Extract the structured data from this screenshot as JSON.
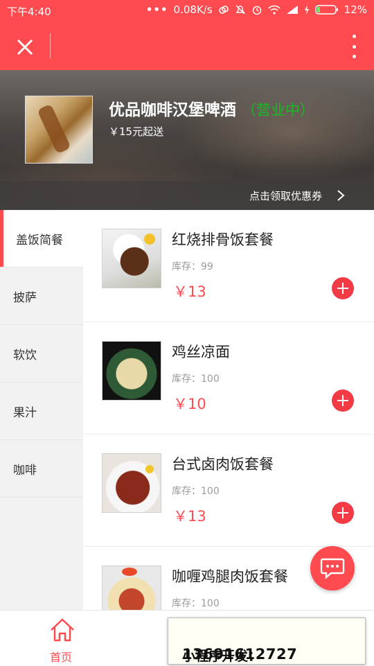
{
  "status": {
    "time": "下午4:40",
    "dots": "•••",
    "speed": "0.08K/s",
    "battery": "12%"
  },
  "shop": {
    "name": "优品咖啡汉堡啤酒",
    "status": "（营业中）",
    "min_order": "￥15元起送",
    "coupon": "点击领取优惠券"
  },
  "categories": [
    {
      "label": "盖饭简餐",
      "active": true
    },
    {
      "label": "披萨"
    },
    {
      "label": "软饮"
    },
    {
      "label": "果汁"
    },
    {
      "label": "咖啡"
    }
  ],
  "items": [
    {
      "name": "红烧排骨饭套餐",
      "stock": "库存：99",
      "price": "￥13"
    },
    {
      "name": "鸡丝凉面",
      "stock": "库存：100",
      "price": "￥10"
    },
    {
      "name": "台式卤肉饭套餐",
      "stock": "库存：100",
      "price": "￥13"
    },
    {
      "name": "咖喱鸡腿肉饭套餐",
      "stock": "库存：100",
      "price": ""
    }
  ],
  "tabbar": {
    "home": "首页"
  },
  "promo": {
    "label": "小程序开发：",
    "phone": "13691612727"
  },
  "colors": {
    "accent": "#ff4a4f",
    "open_status": "#1fb52a",
    "add_button": "#f23b45"
  }
}
